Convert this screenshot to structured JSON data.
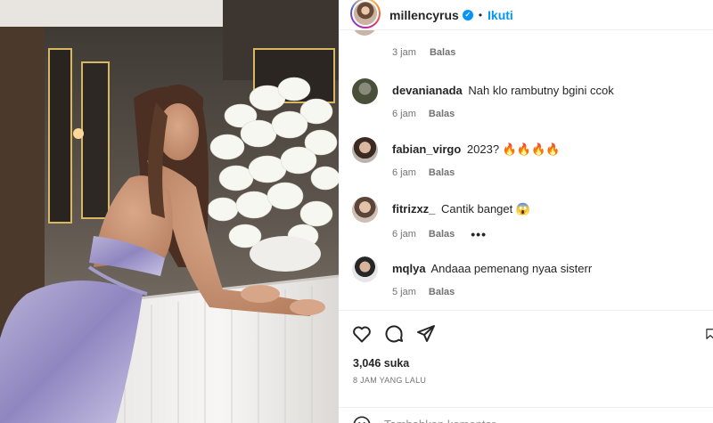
{
  "post": {
    "author": "millencyrus",
    "follow_label": "Ikuti",
    "separator": "•",
    "likes": "3,046 suka",
    "time_ago": "8 JAM YANG LALU",
    "comment_placeholder": "Tambahkan komentar..."
  },
  "first_comment_meta": {
    "time": "3 jam",
    "reply": "Balas"
  },
  "comments": [
    {
      "user": "devanianada",
      "text": "Nah klo rambutny bgini ccok",
      "time": "6 jam",
      "reply": "Balas",
      "has_more": false
    },
    {
      "user": "fabian_virgo",
      "text": "2023?",
      "emoji": "🔥🔥🔥🔥",
      "time": "6 jam",
      "reply": "Balas",
      "has_more": false
    },
    {
      "user": "fitrizxz_",
      "text": "Cantik banget",
      "emoji": "😱",
      "time": "6 jam",
      "reply": "Balas",
      "more": "•••"
    },
    {
      "user": "mqlya",
      "text": "Andaaa pemenang nyaa sisterr",
      "time": "5 jam",
      "reply": "Balas"
    }
  ],
  "colors": {
    "link_blue": "#0095f6",
    "meta_grey": "#737373",
    "text": "#262626"
  },
  "icons": [
    "verified-icon",
    "heart-icon",
    "comment-icon",
    "share-icon",
    "bookmark-icon",
    "emoji-icon"
  ]
}
